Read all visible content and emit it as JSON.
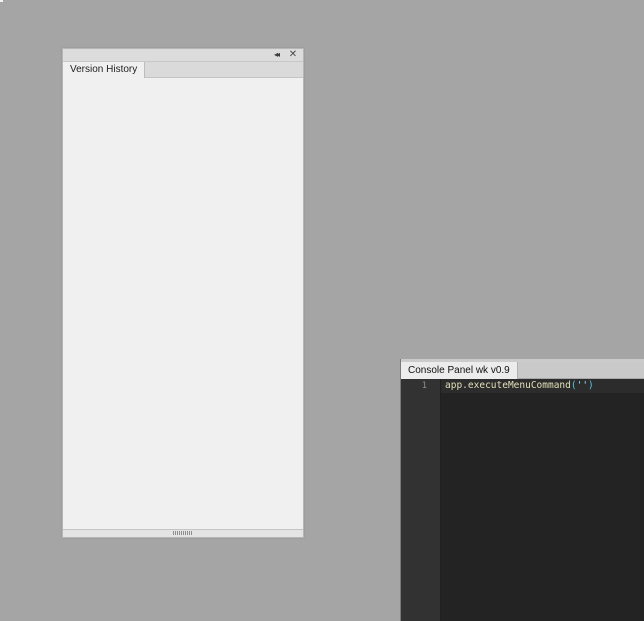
{
  "version_history_panel": {
    "collapse_icon": "double-chevron-left-icon",
    "close_icon": "close-icon",
    "tab_label": "Version History"
  },
  "console_panel": {
    "tab_label": "Console Panel wk v0.9",
    "line_numbers": [
      "1"
    ],
    "code": {
      "object": "app",
      "dot": ".",
      "method": "executeMenuCommand",
      "paren_open": "(",
      "string": "''",
      "paren_close": ")"
    }
  },
  "colors": {
    "workspace_background": "#a5a5a5",
    "panel_background": "#f0f0f0",
    "editor_background": "#232323",
    "gutter_background": "#323232",
    "paren_color": "#4fc9e6"
  }
}
